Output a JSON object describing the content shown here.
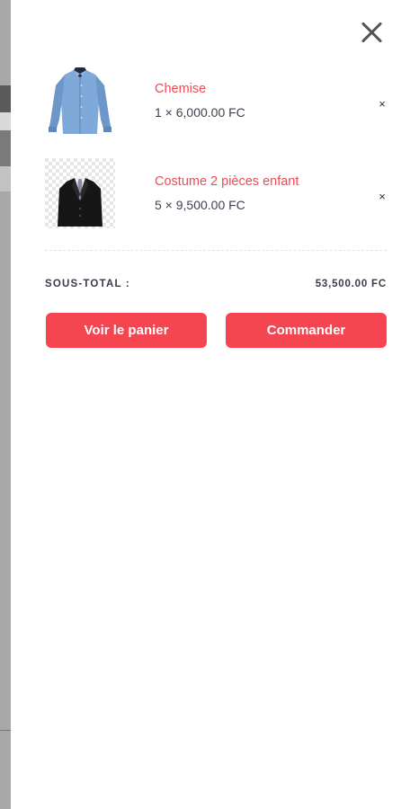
{
  "cart": {
    "close_icon": "close-icon",
    "items": [
      {
        "name": "Chemise",
        "quantity_price": "1 × 6,000.00 FC",
        "remove_label": "×",
        "image": "blue-shirt"
      },
      {
        "name": "Costume 2 pièces enfant",
        "quantity_price": "5 × 9,500.00 FC",
        "remove_label": "×",
        "image": "black-suit"
      }
    ],
    "subtotal_label": "SOUS-TOTAL :",
    "subtotal_value": "53,500.00 FC",
    "view_cart_label": "Voir le panier",
    "checkout_label": "Commander"
  },
  "colors": {
    "accent": "#f54550",
    "item_name": "#f04a55",
    "text_dark": "#3a3a48"
  }
}
